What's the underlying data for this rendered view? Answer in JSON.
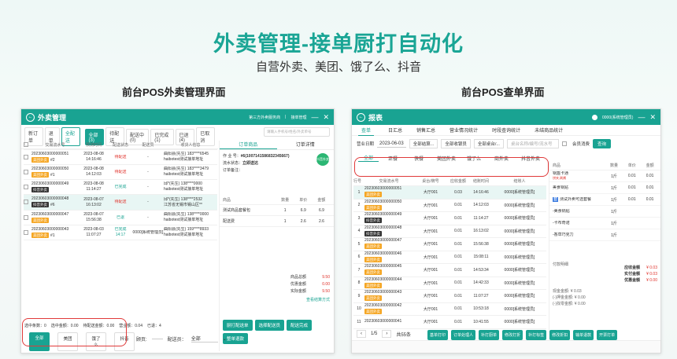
{
  "hero": {
    "title": "外卖管理-接单厨打自动化",
    "subtitle": "自营外卖、美团、饿了么、抖音"
  },
  "left": {
    "section_title": "前台POS外卖管理界面",
    "window_title": "外卖管理",
    "title_right": [
      "第三方外卖服务商",
      "接单管理"
    ],
    "tabs": [
      "新订单",
      "退单",
      "全配送",
      "全部(3)",
      "待配送",
      "配送中(0)",
      "已完成(1)",
      "已退(4)",
      "已取消"
    ],
    "search_placeholder": "请输入手机号/姓名/外卖单号",
    "columns": [
      "交易流水号",
      "预测时间",
      "配送状态",
      "配送员",
      "收货人信息"
    ],
    "orders": [
      {
        "no": "20230603000000051",
        "tag": "美团外卖",
        "num": "#2",
        "time": "2023-08-08\n14:16:46",
        "status": "待配送",
        "rider": "-",
        "info": "曲阳县(先生) 183****6545\nhaibotest测试接单地址"
      },
      {
        "no": "20230603000000050",
        "tag": "美团外卖",
        "num": "#1",
        "time": "2023-08-08\n14:12:03",
        "status": "待配送",
        "rider": "-",
        "info": "曲阳县(先生) 183****3479\nhaibotest测试接单地址"
      },
      {
        "no": "20230603000000049",
        "tag": "抖音外卖",
        "num": "",
        "time": "2023-08-08\n11:14:27",
        "status": "已完成",
        "rider": "-",
        "info": "邱*(先生) 138****0000\nhaibotest测试接单地址"
      },
      {
        "no": "20230603000000048",
        "tag": "抖音外卖",
        "num": "#6",
        "time": "2023-08-07\n16:13:02",
        "status": "待配送",
        "rider": "-",
        "info": "邱*(先生) 138****2532\n江苏省无锡市锡山区**"
      },
      {
        "no": "20230603000000047",
        "tag": "美团外卖",
        "num": "",
        "time": "2023-08-07\n15:56:38",
        "status": "已退",
        "rider": "-",
        "info": "曲阳县(先生) 138****0000\nhaibotest测试接单地址"
      },
      {
        "no": "20230603000000043",
        "tag": "美团外卖",
        "num": "#1",
        "time": "2023-08-03\n11:07:27",
        "status": "已完成\n14:17",
        "rider": "0000[系统管理员]",
        "info": "曲阳县(先生) 159****8933\nhaibotest测试接单地址"
      }
    ],
    "detail_tabs": [
      "订单商品",
      "订单详情"
    ],
    "detail": {
      "order_label": "作 业 号：",
      "order_val": "#6(1007141586832345667)",
      "status_label": "流水状态：",
      "status_val": "立即送达",
      "remark_label": "订单备注：",
      "tag": "抖音外卖"
    },
    "item_cols": [
      "商品",
      "数量",
      "单价",
      "金额"
    ],
    "items": [
      {
        "name": "测试商品套餐包",
        "qty": "1",
        "price": "6.9",
        "amt": "6.9"
      },
      {
        "name": "配送费",
        "qty": "1",
        "price": "2.6",
        "amt": "2.6"
      }
    ],
    "totals": [
      {
        "k": "商品总额",
        "v": "9.50"
      },
      {
        "k": "优惠金额",
        "v": "0.00"
      },
      {
        "k": "实际金额",
        "v": "9.50"
      }
    ],
    "pay_link": "查看结算方式",
    "stat_bar": [
      "选中条数：0",
      "选中金额：0.00",
      "待配送金额：0.00",
      "营业额：0.04",
      "已退：4"
    ],
    "bottom_btns": [
      "全部",
      "美团",
      "饿了么",
      "抖音"
    ],
    "page_label": "顾页:",
    "page_val": "配送员：",
    "page_sel": "全部",
    "action_btns": [
      "厨打配送单",
      "选择配送员",
      "配送完成",
      "整单退款"
    ]
  },
  "right": {
    "section_title": "前台POS查单界面",
    "window_title": "报表",
    "user": "0000(系统管理员)",
    "tabs": [
      "查单",
      "日汇总",
      "销售汇总",
      "营业情况统计",
      "时段查询统计",
      "未结商品统计"
    ],
    "filters": {
      "date_label": "营业日期",
      "date": "2023-06-03",
      "f1": "全部结算...",
      "f2": "全部收银员",
      "f3": "全部桌台/...",
      "search": "桌台名称/编号/流水号",
      "member": "会员消费",
      "query": "查询"
    },
    "chan_tabs": [
      "全部",
      "正餐",
      "快餐",
      "美团外卖",
      "饿了么",
      "商外卖",
      "抖音外卖"
    ],
    "cols": [
      "行号",
      "交易流水号",
      "桌台/牌号",
      "应收金额",
      "结账时间",
      "结账人"
    ],
    "rows": [
      {
        "i": "1",
        "no": "20230603000000051",
        "tag": "美团外卖",
        "table": "大厅001",
        "amt": "0.03",
        "t": "14:16:46",
        "u": "0000[系统管理员]"
      },
      {
        "i": "2",
        "no": "20230603000000050",
        "tag": "美团外卖",
        "table": "大厅001",
        "amt": "0.01",
        "t": "14:12:03",
        "u": "0000[系统管理员]"
      },
      {
        "i": "3",
        "no": "20230603000000049",
        "tag": "抖音外卖",
        "table": "大厅001",
        "amt": "0.01",
        "t": "11:14:27",
        "u": "0000[系统管理员]"
      },
      {
        "i": "4",
        "no": "20230603000000048",
        "tag": "抖音外卖",
        "table": "大厅001",
        "amt": "0.01",
        "t": "16:13:02",
        "u": "0000[系统管理员]"
      },
      {
        "i": "5",
        "no": "20230603000000047",
        "tag": "美团外卖",
        "table": "大厅001",
        "amt": "0.01",
        "t": "15:56:38",
        "u": "0000[系统管理员]"
      },
      {
        "i": "6",
        "no": "20230603000000046",
        "tag": "美团外卖",
        "table": "大厅001",
        "amt": "0.01",
        "t": "15:08:11",
        "u": "0000[系统管理员]"
      },
      {
        "i": "7",
        "no": "20230603000000045",
        "tag": "美团外卖",
        "table": "大厅001",
        "amt": "0.01",
        "t": "14:53:34",
        "u": "0000[系统管理员]"
      },
      {
        "i": "8",
        "no": "20230603000000044",
        "tag": "美团外卖",
        "table": "大厅001",
        "amt": "0.01",
        "t": "14:42:33",
        "u": "0000[系统管理员]"
      },
      {
        "i": "9",
        "no": "20230603000000043",
        "tag": "美团外卖",
        "table": "大厅001",
        "amt": "0.01",
        "t": "11:07:27",
        "u": "0000[系统管理员]"
      },
      {
        "i": "10",
        "no": "20230603000000042",
        "tag": "美团外卖",
        "table": "大厅001",
        "amt": "0.01",
        "t": "10:53:18",
        "u": "0000[系统管理员]"
      },
      {
        "i": "11",
        "no": "20230603000000041",
        "tag": "",
        "table": "大厅001",
        "amt": "0.01",
        "t": "10:41:55",
        "u": "0000[系统管理员]"
      }
    ],
    "pager": {
      "page": "1/5",
      "total": "共55条"
    },
    "side_cols": [
      "商品",
      "数量",
      "单价",
      "金额"
    ],
    "side_items": [
      {
        "n": "锅盔卡通",
        "sub": "饼夹,刷酱",
        "q": "1斤",
        "p": "0.01",
        "a": "0.01"
      },
      {
        "n": "美食锅贴",
        "q": "1斤",
        "p": "0.01",
        "a": "0.01"
      },
      {
        "n": "测试外卖可选套餐",
        "badge": "套",
        "q": "1斤",
        "p": "0.01",
        "a": "0.01"
      },
      {
        "n": "-美食锅贴",
        "q": "1斤",
        "p": "",
        "a": ""
      },
      {
        "n": "-卡布奇诺",
        "q": "1斤",
        "p": "",
        "a": ""
      },
      {
        "n": "-香草巧克力",
        "q": "1斤",
        "p": "",
        "a": ""
      }
    ],
    "sums": [
      {
        "k": "应收金额",
        "v": "¥ 0.03"
      },
      {
        "k": "实付金额",
        "v": "¥ 0.03"
      },
      {
        "k": "优惠金额",
        "v": "¥ 0.00"
      }
    ],
    "pay_title": "付款明细",
    "pay_lines": [
      "现金金额: ¥ 0.03",
      "(-)押金金额: ¥ 0.00",
      "(-)找零金额: ¥ 0.00"
    ],
    "bottom_btns": [
      "基单打印",
      "订单处理人",
      "补打厨单",
      "修改打折",
      "补打标签",
      "修改折扣",
      "输单退款",
      "开票打单"
    ]
  }
}
